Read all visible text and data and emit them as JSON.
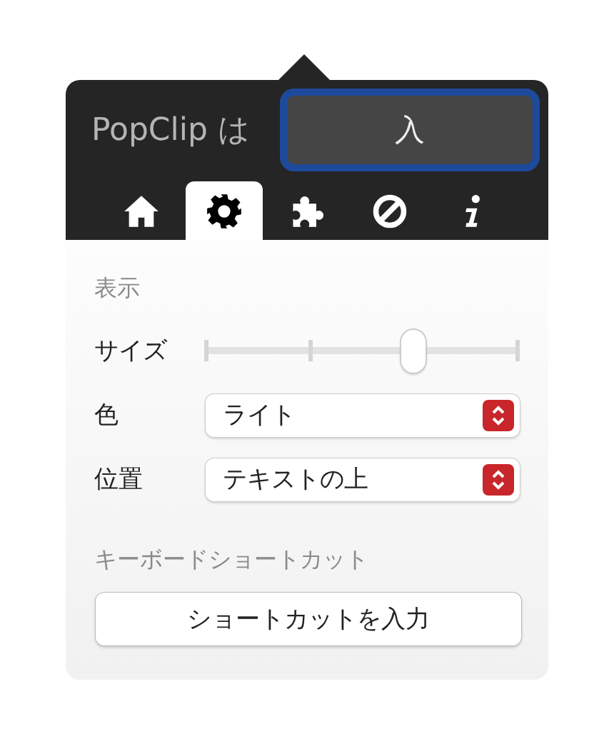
{
  "header": {
    "label": "PopClip は",
    "toggle": {
      "label": "入",
      "focused": true
    }
  },
  "tabs": [
    {
      "kind": "home",
      "selected": false
    },
    {
      "kind": "gear",
      "selected": true
    },
    {
      "kind": "puzzle",
      "selected": false
    },
    {
      "kind": "blocked",
      "selected": false
    },
    {
      "kind": "info",
      "selected": false
    }
  ],
  "display": {
    "heading": "表示",
    "rows": [
      {
        "kind": "slider",
        "label": "サイズ",
        "level": 0.667
      },
      {
        "kind": "popup",
        "label": "色",
        "value": "ライト"
      },
      {
        "kind": "popup",
        "label": "位置",
        "value": "テキストの上"
      }
    ]
  },
  "shortcut": {
    "heading": "キーボードショートカット",
    "button": "ショートカットを入力"
  }
}
